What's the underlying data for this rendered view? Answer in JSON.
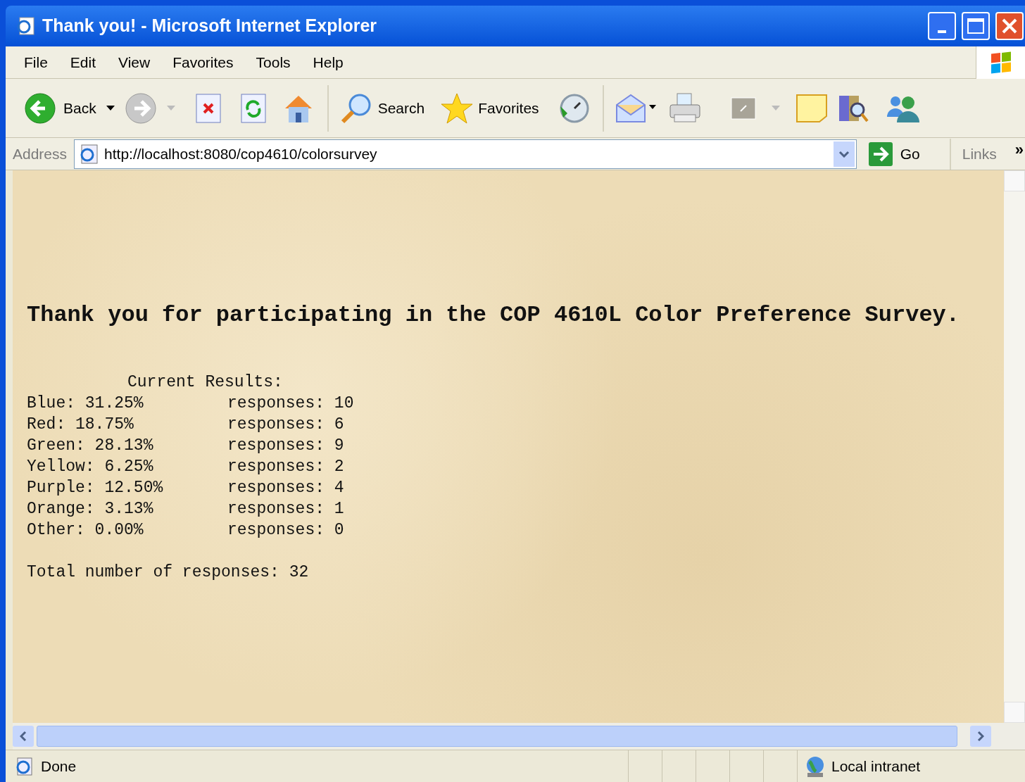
{
  "window": {
    "title": "Thank you! - Microsoft Internet Explorer"
  },
  "menu": [
    "File",
    "Edit",
    "View",
    "Favorites",
    "Tools",
    "Help"
  ],
  "toolbar": {
    "back": "Back",
    "search": "Search",
    "favorites": "Favorites"
  },
  "address_bar": {
    "label": "Address",
    "value": "http://localhost:8080/cop4610/colorsurvey",
    "go": "Go",
    "links": "Links",
    "more": "»"
  },
  "page": {
    "heading": "Thank you for participating in the COP 4610L Color Preference Survey.",
    "results_title": "Current Results:",
    "results": [
      {
        "label": "Blue: 31.25%",
        "responses": "responses: 10"
      },
      {
        "label": "Red: 18.75%",
        "responses": "responses: 6"
      },
      {
        "label": "Green: 28.13%",
        "responses": "responses: 9"
      },
      {
        "label": "Yellow: 6.25%",
        "responses": "responses: 2"
      },
      {
        "label": "Purple: 12.50%",
        "responses": "responses: 4"
      },
      {
        "label": "Orange: 3.13%",
        "responses": "responses: 1"
      },
      {
        "label": "Other: 0.00%",
        "responses": "responses: 0"
      }
    ],
    "total": "Total number of responses: 32"
  },
  "status_bar": {
    "status": "Done",
    "zone": "Local intranet"
  }
}
